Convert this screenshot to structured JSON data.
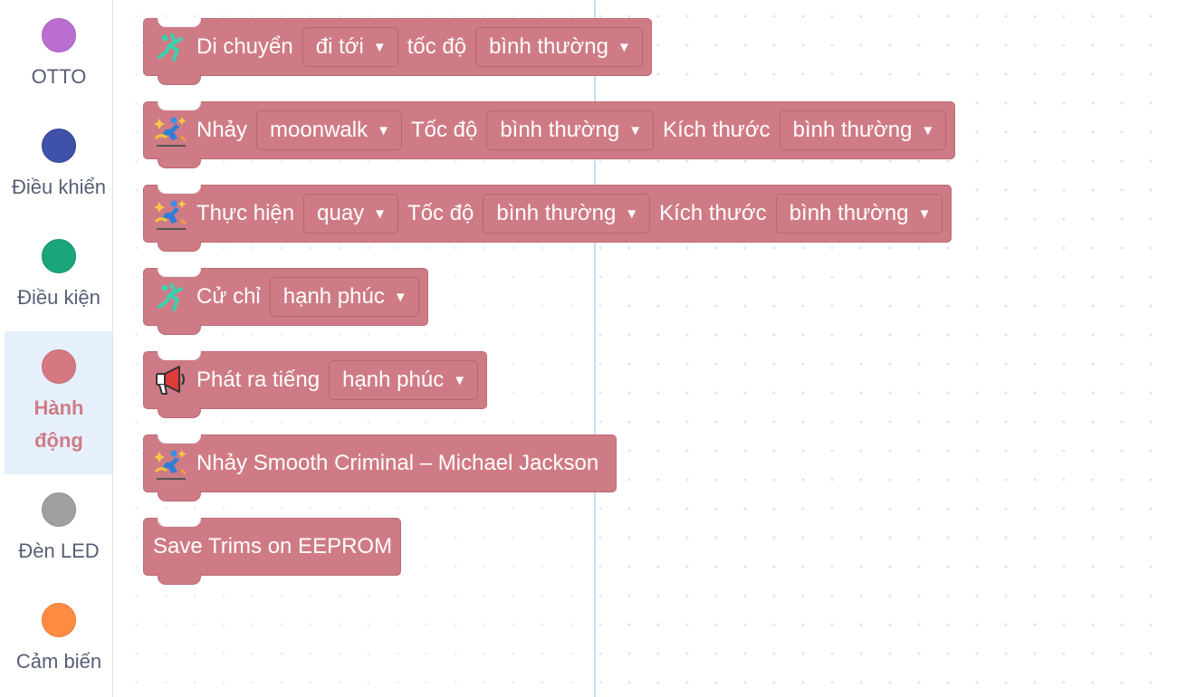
{
  "categories": [
    {
      "label": "OTTO",
      "color": "#b96ed0",
      "selected": false
    },
    {
      "label": "Điều khiển",
      "color": "#3f51a8",
      "selected": false
    },
    {
      "label": "Điều kiện",
      "color": "#1aa57b",
      "selected": false
    },
    {
      "label": "Hành động",
      "color": "#d67882",
      "selected": true
    },
    {
      "label": "Đèn LED",
      "color": "#a0a0a0",
      "selected": false
    },
    {
      "label": "Cảm biến",
      "color": "#ff8c42",
      "selected": false
    }
  ],
  "blocks": {
    "move": {
      "label": "Di chuyển",
      "direction": "đi tới",
      "speed_label": "tốc độ",
      "speed": "bình thường",
      "icon": "running-figure-icon"
    },
    "dance": {
      "label": "Nhảy",
      "dance": "moonwalk",
      "speed_label": "Tốc độ",
      "speed": "bình thường",
      "size_label": "Kích thước",
      "size": "bình thường",
      "icon": "dance-sparkle-icon"
    },
    "perform": {
      "label": "Thực hiện",
      "action": "quay",
      "speed_label": "Tốc độ",
      "speed": "bình thường",
      "size_label": "Kích thước",
      "size": "bình thường",
      "icon": "dance-sparkle-icon"
    },
    "gesture": {
      "label": "Cử chỉ",
      "gesture": "hạnh phúc",
      "icon": "running-figure-icon"
    },
    "sound": {
      "label": "Phát ra tiếng",
      "sound": "hạnh phúc",
      "icon": "megaphone-icon"
    },
    "smooth_criminal": {
      "label": "Nhảy Smooth Criminal – Michael Jackson",
      "icon": "dance-sparkle-icon"
    },
    "save_trims": {
      "label": "Save Trims on EEPROM"
    }
  },
  "dropdown_arrow": "▼",
  "colors": {
    "block": "#cf7b85",
    "block_border": "#ba6b75",
    "selected_label": "#cf7c86",
    "sidebar_selected_bg": "#e6f0fb"
  }
}
